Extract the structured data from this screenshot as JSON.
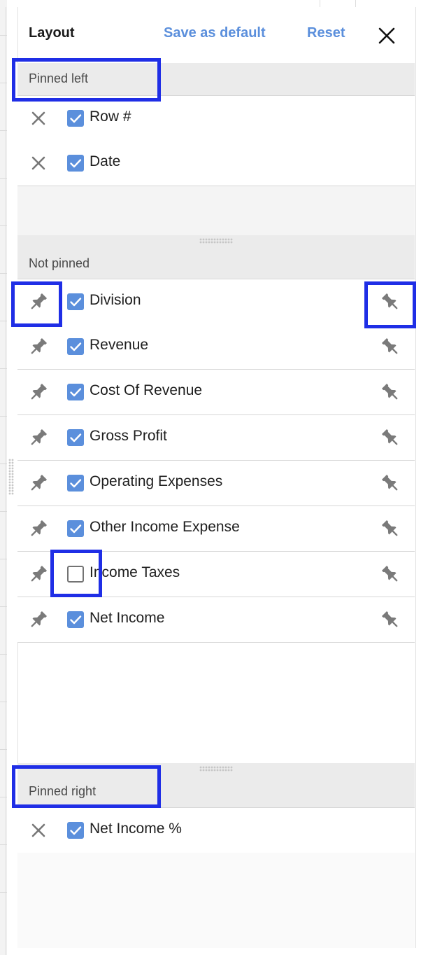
{
  "header": {
    "title": "Layout",
    "save_default_label": "Save as default",
    "reset_label": "Reset",
    "close_icon": "close-icon"
  },
  "sections": {
    "pinned_left": {
      "label": "Pinned left",
      "rows": [
        {
          "label": "Row #",
          "checked": true,
          "lead_icon": "unpin-x-icon"
        },
        {
          "label": "Date",
          "checked": true,
          "lead_icon": "unpin-x-icon"
        }
      ]
    },
    "not_pinned": {
      "label": "Not pinned",
      "rows": [
        {
          "label": "Division",
          "checked": true,
          "lead_icon": "pin-left-icon",
          "trail_icon": "pin-right-icon"
        },
        {
          "label": "Revenue",
          "checked": true,
          "lead_icon": "pin-left-icon",
          "trail_icon": "pin-right-icon"
        },
        {
          "label": "Cost Of Revenue",
          "checked": true,
          "lead_icon": "pin-left-icon",
          "trail_icon": "pin-right-icon"
        },
        {
          "label": "Gross Profit",
          "checked": true,
          "lead_icon": "pin-left-icon",
          "trail_icon": "pin-right-icon"
        },
        {
          "label": "Operating Expenses",
          "checked": true,
          "lead_icon": "pin-left-icon",
          "trail_icon": "pin-right-icon"
        },
        {
          "label": "Other Income Expense",
          "checked": true,
          "lead_icon": "pin-left-icon",
          "trail_icon": "pin-right-icon"
        },
        {
          "label": "Income Taxes",
          "checked": false,
          "lead_icon": "pin-left-icon",
          "trail_icon": "pin-right-icon"
        },
        {
          "label": "Net Income",
          "checked": true,
          "lead_icon": "pin-left-icon",
          "trail_icon": "pin-right-icon"
        }
      ]
    },
    "pinned_right": {
      "label": "Pinned right",
      "rows": [
        {
          "label": "Net Income %",
          "checked": true,
          "lead_icon": "unpin-x-icon"
        }
      ]
    }
  },
  "colors": {
    "accent": "#5b8fdc",
    "highlight": "#1f2ee6",
    "section_header": "#ebebeb",
    "icon_gray": "#7a7a7a"
  }
}
